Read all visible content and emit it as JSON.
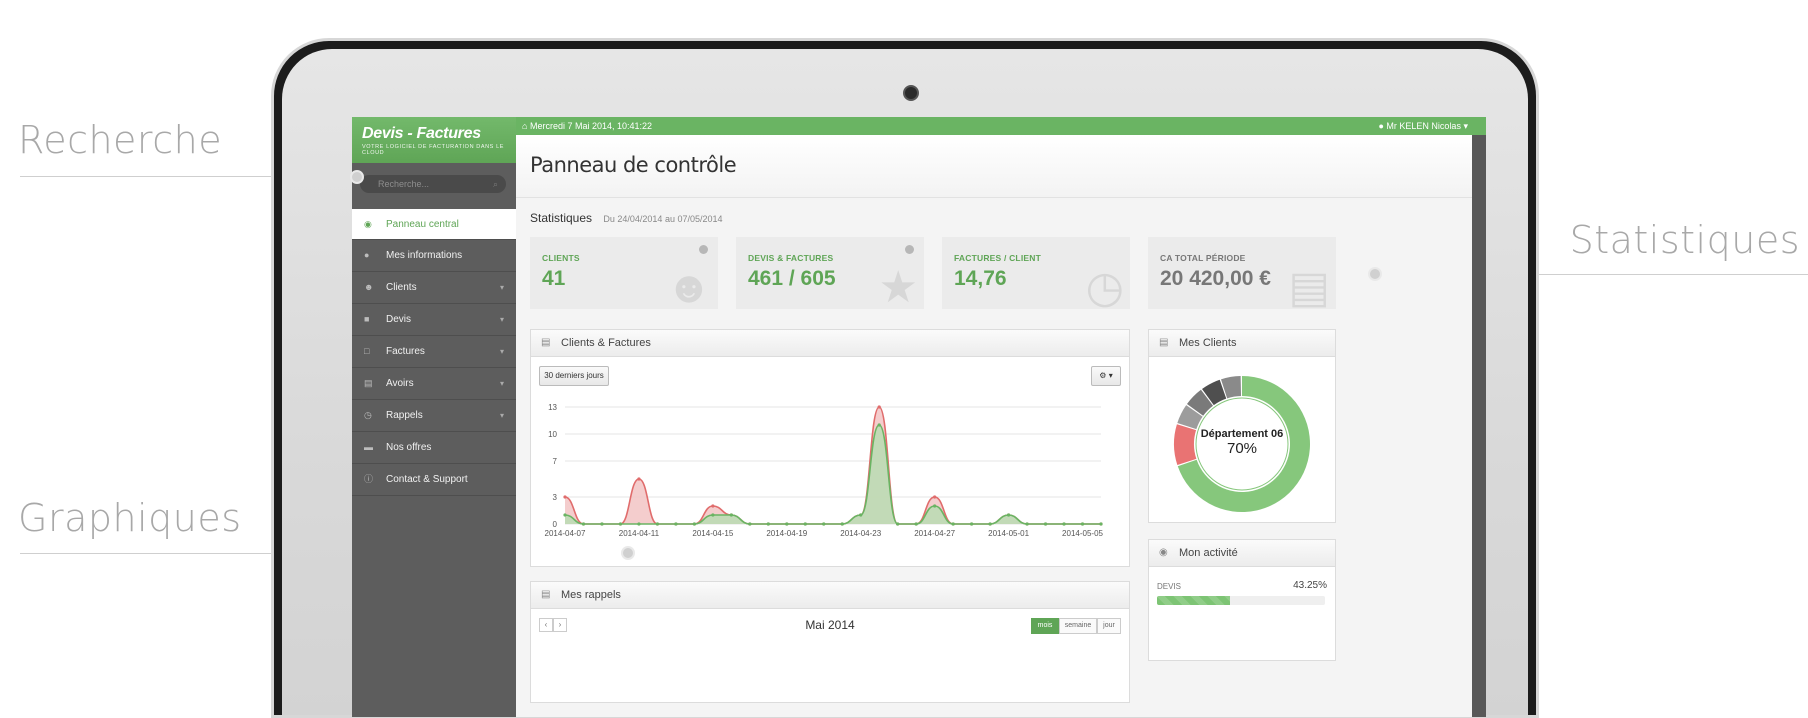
{
  "callouts": {
    "search": "Recherche",
    "charts": "Graphiques",
    "stats": "Statistiques"
  },
  "app": {
    "logo_title": "Devis - Factures",
    "logo_subtitle": "VOTRE LOGICIEL DE FACTURATION DANS LE CLOUD",
    "date": "Mercredi 7 Mai 2014, 10:41:22",
    "user": "Mr KELEN Nicolas",
    "accent": "#5fa556"
  },
  "search": {
    "placeholder": "Recherche..."
  },
  "sidebar": {
    "items": [
      {
        "label": "Panneau central",
        "icon": "dashboard-icon"
      },
      {
        "label": "Mes informations",
        "icon": "user-info-icon"
      },
      {
        "label": "Clients",
        "icon": "user-icon"
      },
      {
        "label": "Devis",
        "icon": "folder-icon"
      },
      {
        "label": "Factures",
        "icon": "folder-open-icon"
      },
      {
        "label": "Avoirs",
        "icon": "calendar-icon"
      },
      {
        "label": "Rappels",
        "icon": "clock-icon"
      },
      {
        "label": "Nos offres",
        "icon": "card-icon"
      },
      {
        "label": "Contact & Support",
        "icon": "info-icon"
      }
    ]
  },
  "page": {
    "title": "Panneau de contrôle",
    "stats_title": "Statistiques",
    "stats_range": "Du 24/04/2014 au 07/05/2014"
  },
  "cards": [
    {
      "label": "CLIENTS",
      "value": "41",
      "icon": "user-silhouette-icon"
    },
    {
      "label": "DEVIS & FACTURES",
      "value": "461 / 605",
      "icon": "star-icon"
    },
    {
      "label": "FACTURES / CLIENT",
      "value": "14,76",
      "icon": "clock-icon"
    },
    {
      "label": "CA TOTAL PÉRIODE",
      "value": "20 420,00 €",
      "icon": "money-icon"
    }
  ],
  "chart_panel": {
    "title": "Clients & Factures",
    "range_button": "30 derniers jours"
  },
  "chart_data": {
    "type": "area",
    "x_ticks": [
      "2014-04-07",
      "2014-04-11",
      "2014-04-15",
      "2014-04-19",
      "2014-04-23",
      "2014-04-27",
      "2014-05-01",
      "2014-05-05"
    ],
    "y_ticks": [
      0,
      3,
      7,
      10,
      13
    ],
    "ylim": [
      0,
      14
    ],
    "x": [
      "2014-04-07",
      "2014-04-08",
      "2014-04-09",
      "2014-04-10",
      "2014-04-11",
      "2014-04-12",
      "2014-04-13",
      "2014-04-14",
      "2014-04-15",
      "2014-04-16",
      "2014-04-17",
      "2014-04-18",
      "2014-04-19",
      "2014-04-20",
      "2014-04-21",
      "2014-04-22",
      "2014-04-23",
      "2014-04-24",
      "2014-04-25",
      "2014-04-26",
      "2014-04-27",
      "2014-04-28",
      "2014-04-29",
      "2014-04-30",
      "2014-05-01",
      "2014-05-02",
      "2014-05-03",
      "2014-05-04",
      "2014-05-05",
      "2014-05-06"
    ],
    "series": [
      {
        "color": "#e06c6c",
        "fill": "#f2c4c4",
        "values": [
          3,
          0,
          0,
          0,
          5,
          0,
          0,
          0,
          2,
          1,
          0,
          0,
          0,
          0,
          0,
          0,
          1,
          13,
          0,
          0,
          3,
          0,
          0,
          0,
          1,
          0,
          0,
          0,
          0,
          0
        ]
      },
      {
        "color": "#6ab463",
        "fill": "#b9dcb3",
        "values": [
          1,
          0,
          0,
          0,
          0,
          0,
          0,
          0,
          1,
          1,
          0,
          0,
          0,
          0,
          0,
          0,
          1,
          11,
          0,
          0,
          2,
          0,
          0,
          0,
          1,
          0,
          0,
          0,
          0,
          0
        ]
      }
    ],
    "grid": true
  },
  "clients_panel": {
    "title": "Mes Clients",
    "donut_label": "Département 06",
    "donut_value": "70%",
    "segments": [
      {
        "value": 70,
        "color": "#86c77c"
      },
      {
        "value": 10,
        "color": "#e97373"
      },
      {
        "value": 5,
        "color": "#9c9c9c"
      },
      {
        "value": 5,
        "color": "#7a7a7a"
      },
      {
        "value": 5,
        "color": "#4f4f4f"
      },
      {
        "value": 5,
        "color": "#8a8a8a"
      }
    ]
  },
  "activity_panel": {
    "title": "Mon activité",
    "label": "DEVIS",
    "value": "43.25%",
    "percent": 43.25
  },
  "reminders_panel": {
    "title": "Mes rappels",
    "month": "Mai 2014",
    "views": [
      "mois",
      "semaine",
      "jour"
    ]
  }
}
